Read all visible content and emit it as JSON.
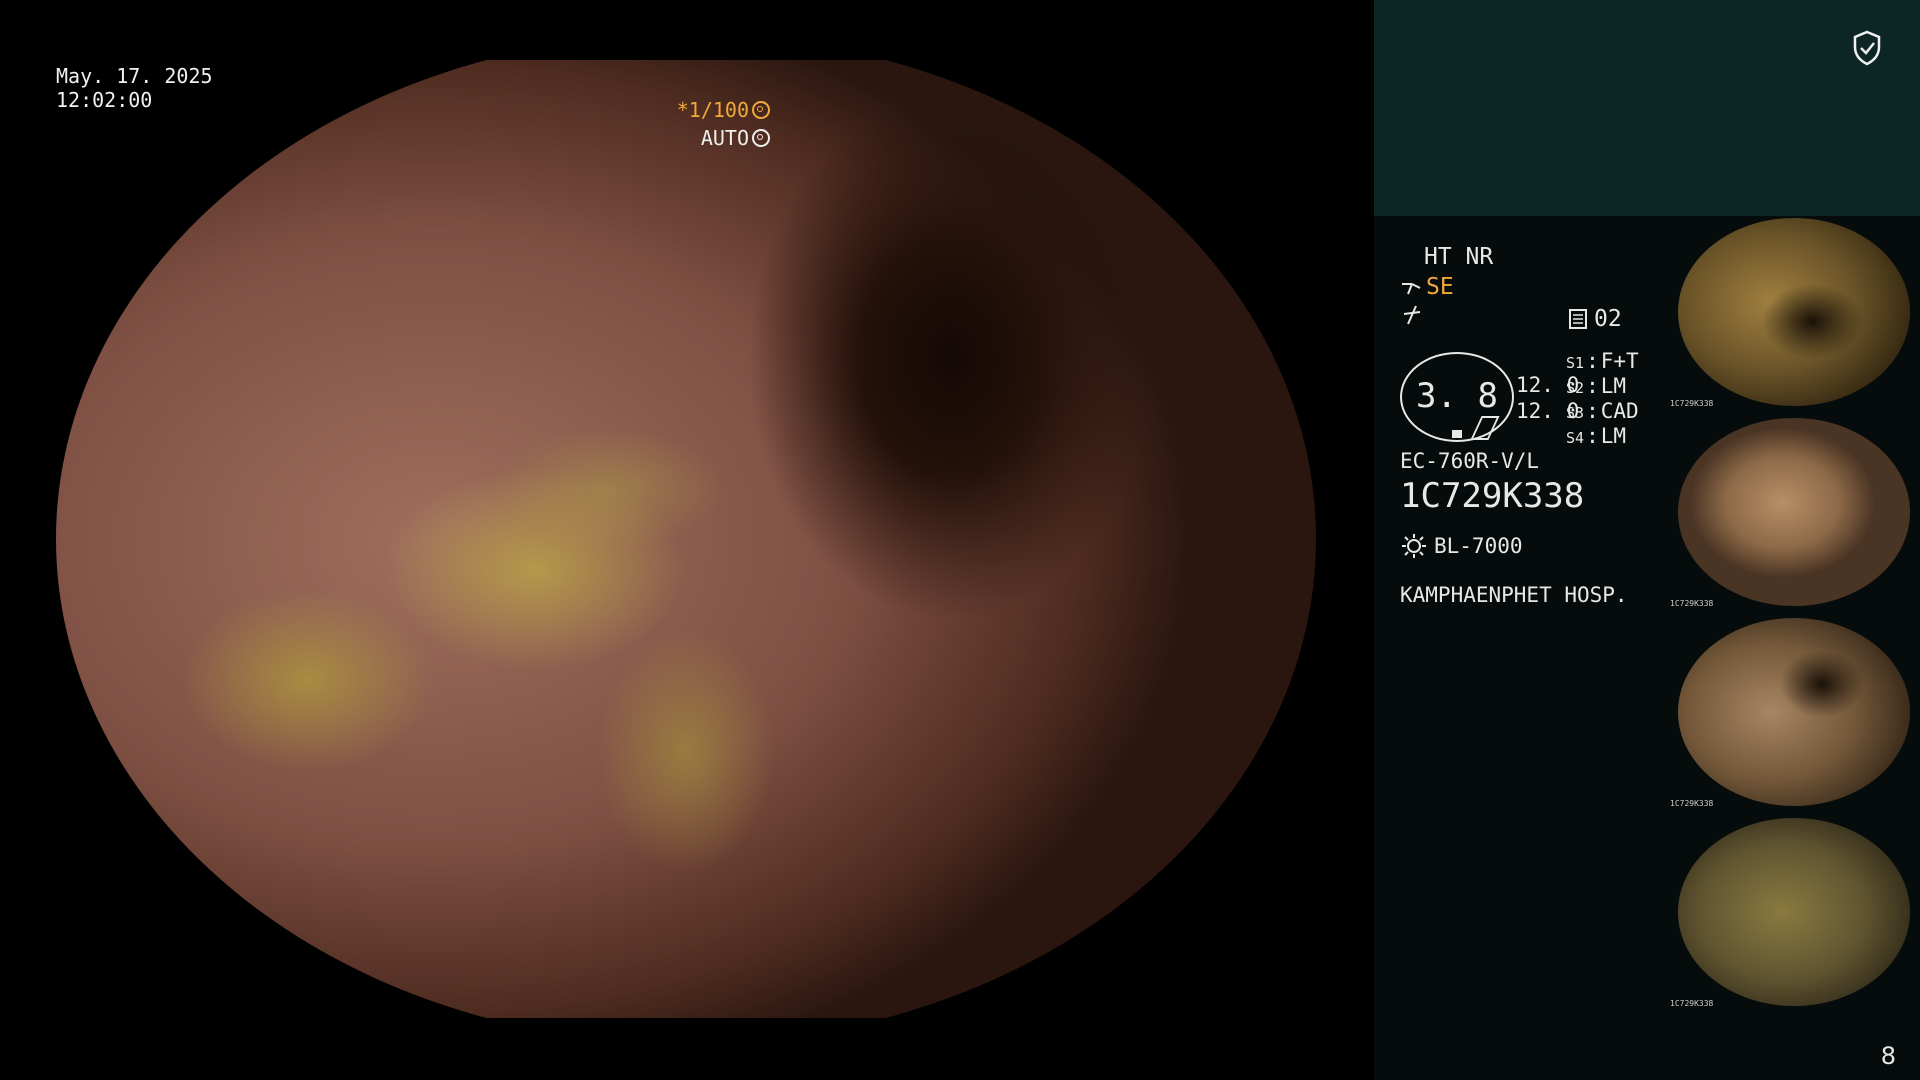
{
  "overlay": {
    "date": "May. 17. 2025",
    "time": "12:02:00",
    "shutter": "*1/100",
    "iris": "AUTO"
  },
  "panel": {
    "enhancement": "HT NR",
    "structure": "SE",
    "mode_number": "02",
    "gauge_value": "3. 8",
    "values": [
      "12. 0",
      "12. 0"
    ],
    "switches": [
      {
        "key": "S1",
        "value": "F+T"
      },
      {
        "key": "S2",
        "value": "LM"
      },
      {
        "key": "S3",
        "value": "CAD"
      },
      {
        "key": "S4",
        "value": "LM"
      }
    ],
    "scope_model": "EC-760R-V/L",
    "serial": "1C729K338",
    "light_source": "BL-7000",
    "hospital": "KAMPHAENPHET HOSP."
  },
  "thumbnails": [
    {
      "label": "1C729K338"
    },
    {
      "label": "1C729K338"
    },
    {
      "label": "1C729K338"
    },
    {
      "label": "1C729K338"
    }
  ],
  "page_number": "8",
  "colors": {
    "panel_header": "#0c2626",
    "panel_bg": "#050c0b",
    "accent_orange": "#f2a93c"
  }
}
